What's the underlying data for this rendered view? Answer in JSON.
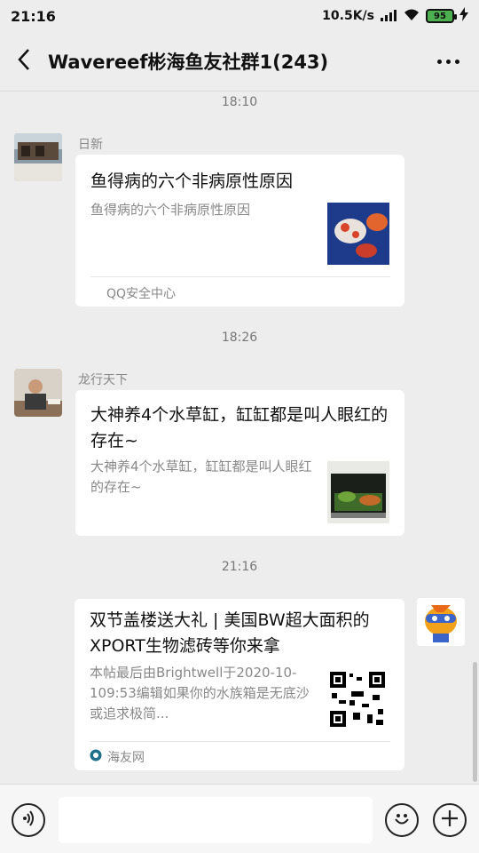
{
  "status_bar": {
    "time": "21:16",
    "network_speed": "10.5K/s",
    "battery": "95",
    "icons": [
      "signal-icon",
      "wifi-icon",
      "battery-icon",
      "charging-icon"
    ]
  },
  "header": {
    "title": "Wavereef彬海鱼友社群1(243)",
    "back_icon": "back-arrow-icon",
    "more_icon": "more-icon"
  },
  "messages": [
    {
      "timestamp": "18:10",
      "sender": "日新",
      "card": {
        "title": "鱼得病的六个非病原性原因",
        "description": "鱼得病的六个非病原性原因",
        "source": "QQ安全中心"
      }
    },
    {
      "timestamp": "18:26",
      "sender": "龙行天下",
      "card": {
        "title": "大神养4个水草缸，缸缸都是叫人眼红的存在~",
        "description": "大神养4个水草缸，缸缸都是叫人眼红的存在~",
        "source": ""
      }
    },
    {
      "timestamp": "21:16",
      "sender": "",
      "card": {
        "title": "双节盖楼送大礼 | 美国BW超大面积的XPORT生物滤砖等你来拿",
        "description": "本帖最后由Brightwell于2020-10-109:53编辑如果你的水族箱是无底沙或追求极简...",
        "source": "海友网"
      }
    }
  ],
  "input_bar": {
    "voice_icon": "voice-icon",
    "emoji_icon": "emoji-icon",
    "add_icon": "add-icon",
    "placeholder": ""
  },
  "colors": {
    "background": "#ededed",
    "card": "#ffffff",
    "battery": "#4caf50"
  }
}
